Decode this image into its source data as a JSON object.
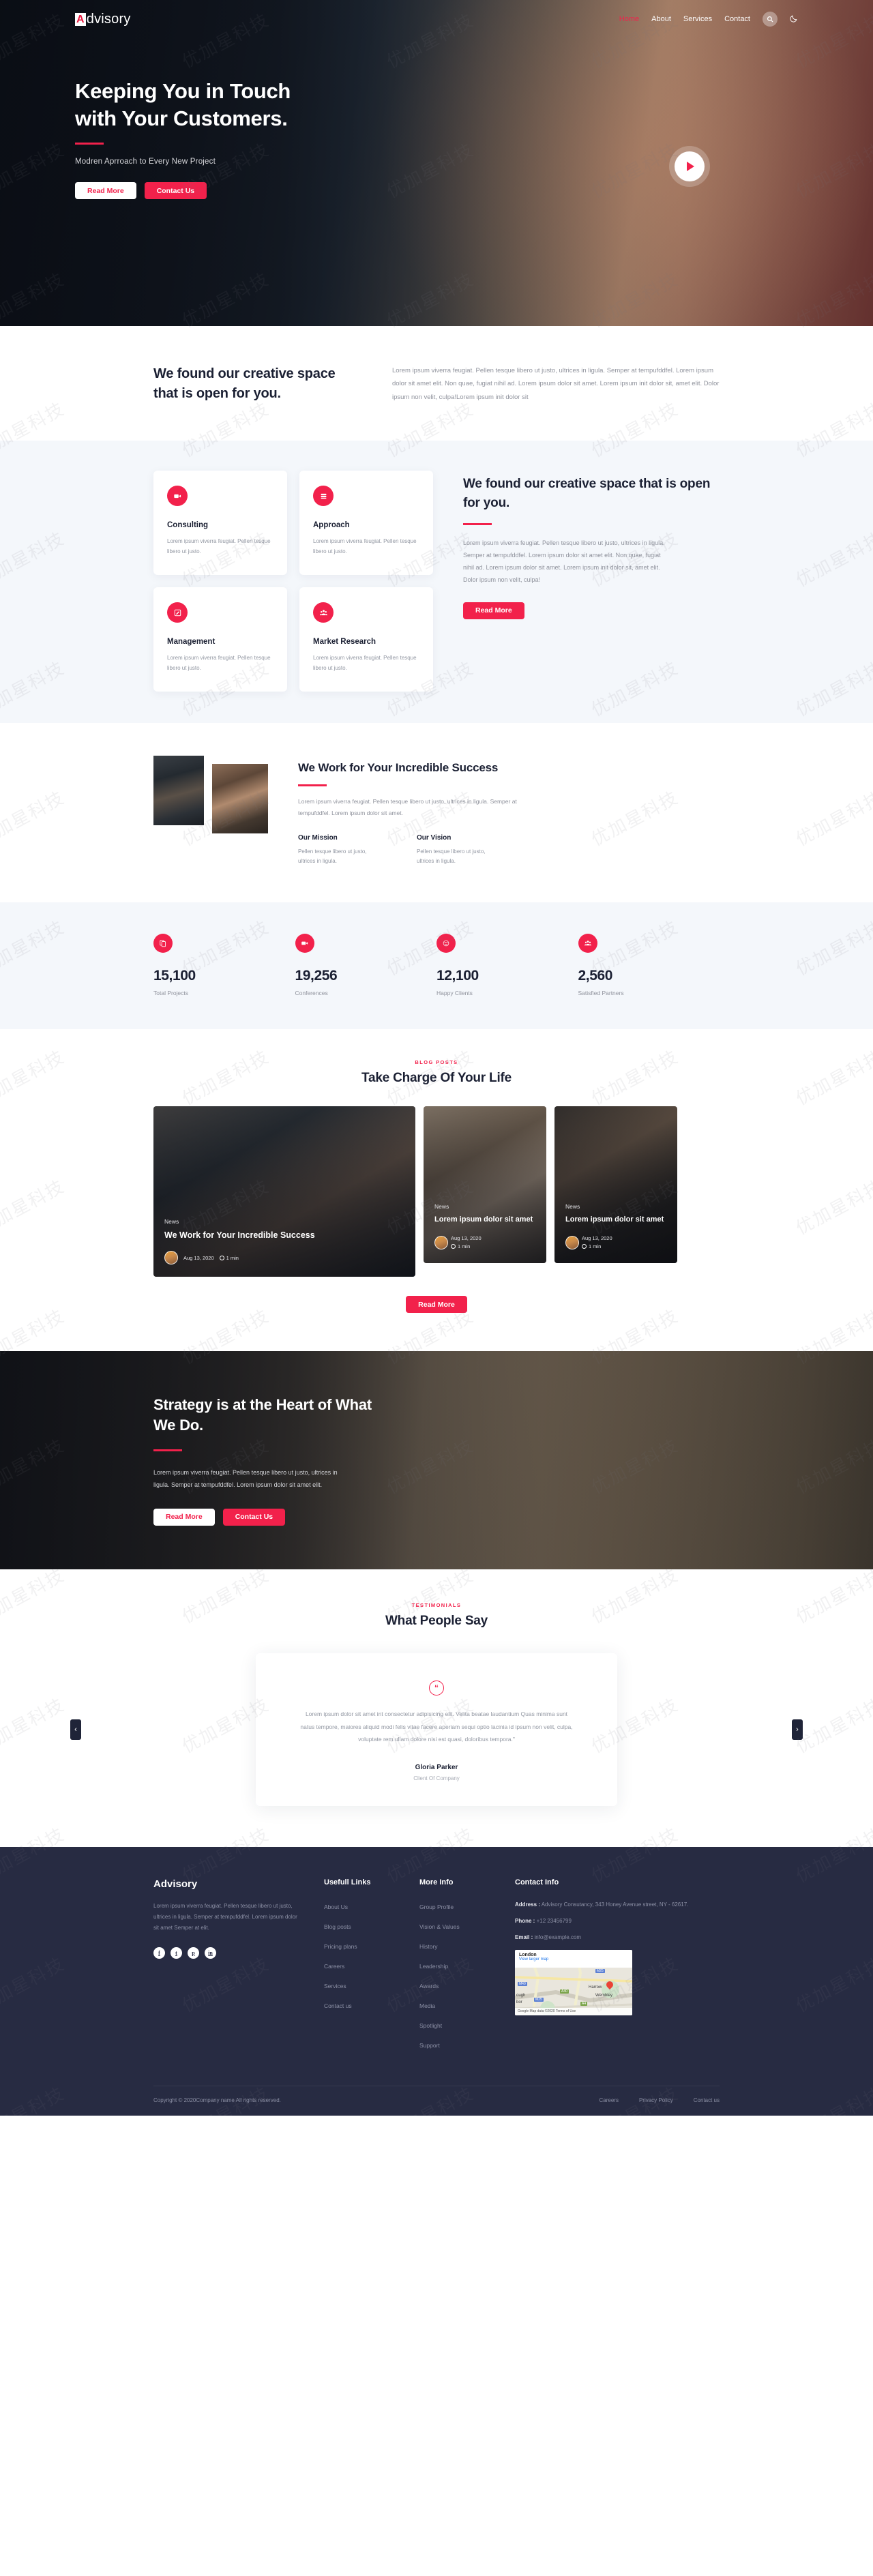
{
  "brand": {
    "logo_first": "A",
    "logo_rest": "dvisory"
  },
  "nav": {
    "items": [
      {
        "label": "Home",
        "active": true
      },
      {
        "label": "About",
        "active": false
      },
      {
        "label": "Services",
        "active": false
      },
      {
        "label": "Contact",
        "active": false
      }
    ],
    "search_icon": "search-icon",
    "theme_icon": "moon-icon"
  },
  "hero": {
    "title": "Keeping You in Touch with Your Customers.",
    "subtitle": "Modren Aprroach to Every New Project",
    "btn_primary": "Read More",
    "btn_secondary": "Contact Us",
    "play_icon": "play-icon"
  },
  "intro": {
    "heading": "We found our creative space that is open for you.",
    "paragraph": "Lorem ipsum viverra feugiat. Pellen tesque libero ut justo, ultrices in ligula. Semper at tempufddfel. Lorem ipsum dolor sit amet elit. Non quae, fugiat nihil ad. Lorem ipsum dolor sit amet. Lorem ipsum init dolor sit, amet elit. Dolor ipsum non velit, culpa!Lorem ipsum init dolor sit"
  },
  "features": {
    "cards": [
      {
        "icon": "video-camera-icon",
        "title": "Consulting",
        "text": "Lorem ipsum viverra feugiat. Pellen tesque libero ut justo."
      },
      {
        "icon": "server-list-icon",
        "title": "Approach",
        "text": "Lorem ipsum viverra feugiat. Pellen tesque libero ut justo."
      },
      {
        "icon": "pencil-edit-icon",
        "title": "Management",
        "text": "Lorem ipsum viverra feugiat. Pellen tesque libero ut justo."
      },
      {
        "icon": "people-group-icon",
        "title": "Market Research",
        "text": "Lorem ipsum viverra feugiat. Pellen tesque libero ut justo."
      }
    ],
    "heading": "We found our creative space that is open for you.",
    "paragraph": "Lorem ipsum viverra feugiat. Pellen tesque libero ut justo, ultrices in ligula. Semper at tempufddfel. Lorem ipsum dolor sit amet elit. Non quae, fugiat nihil ad. Lorem ipsum dolor sit amet. Lorem ipsum init dolor sit, amet elit. Dolor ipsum non velit, culpa!",
    "button": "Read More"
  },
  "work": {
    "heading": "We Work for Your Incredible Success",
    "paragraph": "Lorem ipsum viverra feugiat. Pellen tesque libero ut justo, ultrices in ligula. Semper at tempufddfel. Lorem ipsum dolor sit amet.",
    "mission_title": "Our Mission",
    "mission_text": "Pellen tesque libero ut justo, ultrices in ligula.",
    "vision_title": "Our Vision",
    "vision_text": "Pellen tesque libero ut justo, ultrices in ligula."
  },
  "stats": [
    {
      "icon": "briefcase-icon",
      "number": "15,100",
      "label": "Total Projects"
    },
    {
      "icon": "video-camera-icon",
      "number": "19,256",
      "label": "Conferences"
    },
    {
      "icon": "smiley-icon",
      "number": "12,100",
      "label": "Happy Clients"
    },
    {
      "icon": "people-group-icon",
      "number": "2,560",
      "label": "Satisfied Partners"
    }
  ],
  "blog": {
    "eyebrow": "BLOG POSTS",
    "title": "Take Charge Of Your Life",
    "posts": [
      {
        "category": "News",
        "title": "We Work for Your Incredible Success",
        "date": "Aug 13, 2020",
        "read_time": "1 min"
      },
      {
        "category": "News",
        "title": "Lorem ipsum dolor sit amet",
        "date": "Aug 13, 2020",
        "read_time": "1 min"
      },
      {
        "category": "News",
        "title": "Lorem ipsum dolor sit amet",
        "date": "Aug 13, 2020",
        "read_time": "1 min"
      }
    ],
    "button": "Read More"
  },
  "strategy": {
    "heading": "Strategy is at the Heart of What We Do.",
    "paragraph": "Lorem ipsum viverra feugiat. Pellen tesque libero ut justo, ultrices in ligula. Semper at tempufddfel. Lorem ipsum dolor sit amet elit.",
    "btn_primary": "Read More",
    "btn_secondary": "Contact Us"
  },
  "testimonials": {
    "eyebrow": "TESTIMONIALS",
    "title": "What People Say",
    "quote_icon": "quote-icon",
    "text": "Lorem ipsum dolor sit amet int consectetur adipisicing elit. Velita beatae laudantium Quas minima sunt natus tempore, maiores aliquid modi felis vitae facere aperiam sequi optio lacinia id ipsum non velit, culpa, voluptate rem ullam dolore nisi est quasi, doloribus tempora.\"",
    "name": "Gloria Parker",
    "role": "Client Of Company",
    "prev_icon": "chevron-left-icon",
    "next_icon": "chevron-right-icon"
  },
  "footer": {
    "brand_title": "Advisory",
    "brand_text": "Lorem ipsum viverra feugiat. Pellen tesque libero ut justo, ultrices in ligula. Semper at tempufddfel. Lorem ipsum dolor sit amet Semper at elit.",
    "socials": [
      {
        "icon": "facebook-icon",
        "glyph": "f"
      },
      {
        "icon": "twitter-icon",
        "glyph": "t"
      },
      {
        "icon": "pinterest-icon",
        "glyph": "p"
      },
      {
        "icon": "linkedin-icon",
        "glyph": "in"
      }
    ],
    "useful": {
      "title": "Usefull Links",
      "links": [
        "About Us",
        "Blog posts",
        "Pricing plans",
        "Careers",
        "Services",
        "Contact us"
      ]
    },
    "more": {
      "title": "More Info",
      "links": [
        "Group Profile",
        "Vision & Values",
        "History",
        "Leadership",
        "Awards",
        "Media",
        "Spotlight",
        "Support"
      ]
    },
    "contact": {
      "title": "Contact Info",
      "address_label": "Address :",
      "address_value": " Advisory Consutancy, 343 Honey Avenue street, NY - 62617.",
      "phone_label": "Phone :",
      "phone_value": " +12 23456799",
      "email_label": "Email :",
      "email_value": " info@example.com",
      "map": {
        "title": "London",
        "link": "View larger map",
        "labels": [
          "Harrow",
          "Wembley",
          "ough",
          "bor"
        ],
        "badges": [
          "M25",
          "M40",
          "M25",
          "A40",
          "A4"
        ],
        "footer": "Google  Map data ©2020  Terms of Use"
      }
    },
    "copyright": "Copyright © 2020Company name All rights reserved.",
    "bottom_links": [
      "Careers",
      "Privacy Policy",
      "Contact us"
    ]
  },
  "colors": {
    "accent": "#f2214b",
    "dark": "#1b2033",
    "footer_bg": "#272b42",
    "light_bg": "#f4f7fb"
  }
}
